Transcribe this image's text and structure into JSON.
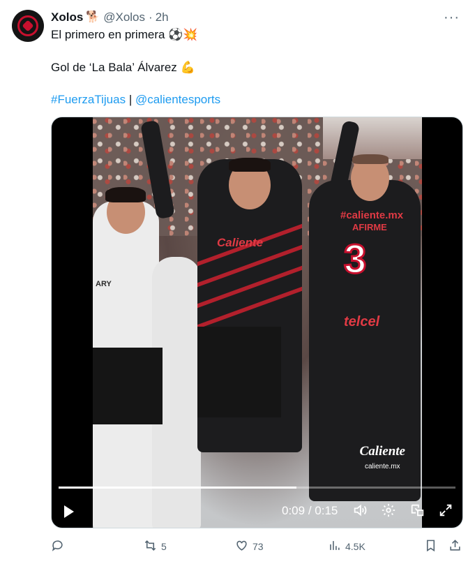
{
  "author": {
    "name": "Xolos",
    "badge_emoji": "🐕",
    "handle": "@Xolos",
    "separator": "·",
    "time": "2h"
  },
  "more_label": "···",
  "text": {
    "line1": "El primero en primera ⚽💥",
    "line2": "Gol de ‘La Bala’ Álvarez 💪",
    "hashtag": "#FuerzaTijuas",
    "divider": " | ",
    "mention": "@calientesports"
  },
  "video": {
    "jersey_number": "3",
    "sponsor_top": "#caliente.mx",
    "sponsor_afirme": "AFIRME",
    "sponsor_telcel": "telcel",
    "sponsor_front": "Caliente",
    "jersey_back_text": "ARY",
    "watermark_logo": "Caliente",
    "watermark_domain": "caliente.mx",
    "current_time": "0:09",
    "duration": "0:15",
    "time_separator": " / ",
    "progress": 0.6
  },
  "actions": {
    "reply_count": "",
    "retweet_count": "5",
    "like_count": "73",
    "views_count": "4.5K"
  },
  "colors": {
    "link": "#1d9bf0",
    "muted": "#536471",
    "brand_red": "#c8102e"
  },
  "icons": [
    "more-icon",
    "play-icon",
    "volume-icon",
    "settings-icon",
    "pip-icon",
    "fullscreen-icon",
    "reply-icon",
    "retweet-icon",
    "like-icon",
    "views-icon",
    "bookmark-icon",
    "share-icon"
  ]
}
